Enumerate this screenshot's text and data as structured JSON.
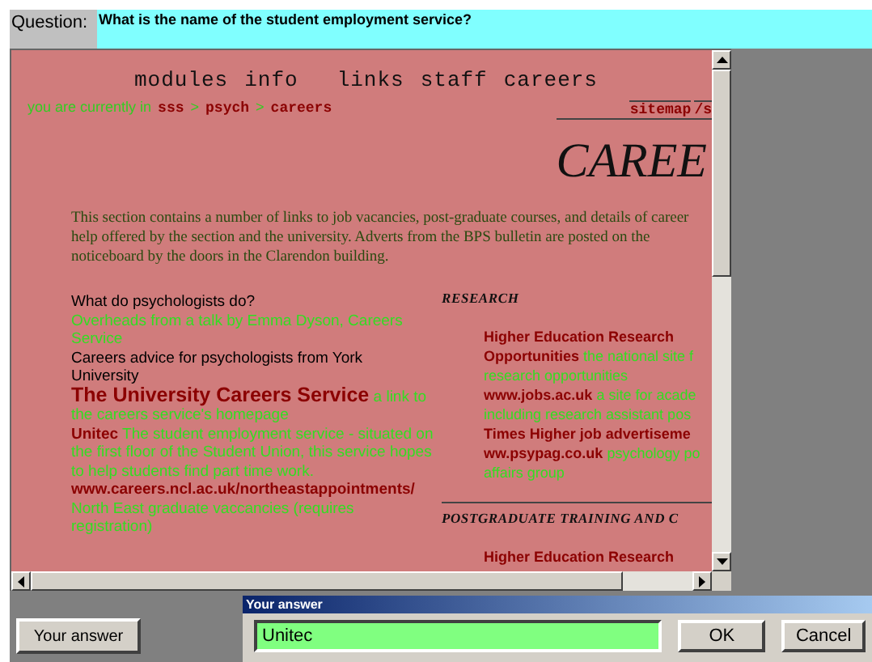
{
  "question": {
    "label": "Question:",
    "text": "What is the name of the student employment service?"
  },
  "page": {
    "nav": [
      "modules",
      "info",
      "links",
      "staff",
      "careers"
    ],
    "breadcrumb": [
      {
        "text": "you are currently in",
        "kind": "plain"
      },
      {
        "text": "sss",
        "kind": "link"
      },
      {
        "text": ">",
        "kind": "plain"
      },
      {
        "text": "psych",
        "kind": "link"
      },
      {
        "text": ">",
        "kind": "plain"
      },
      {
        "text": "careers",
        "kind": "link"
      }
    ],
    "sitemap": [
      "sitemap",
      "/s"
    ],
    "title": "CAREE",
    "intro": [
      "This section contains a number of links to job vacancies, post-graduate courses, and details of career",
      "help offered by the section and the university. Adverts from the BPS bulletin are posted on the",
      "noticeboard by the doors in the Clarendon building."
    ],
    "left_items": [
      [
        {
          "text": "What do psychologists do?",
          "kind": "link"
        }
      ],
      [
        {
          "text": "Overheads from a talk by Emma Dyson, Careers Service",
          "kind": "desc"
        }
      ],
      [
        {
          "text": "Careers advice for psychologists from York University",
          "kind": "link"
        }
      ],
      [
        {
          "text": "The University Careers Service",
          "kind": "biglink"
        },
        {
          "text": "a link to the careers service's homepage",
          "kind": "desc"
        }
      ],
      [
        {
          "text": "Unitec",
          "kind": "link"
        },
        {
          "text": "The student employment service - situated on the first floor of the Student Union, this service hopes to help students find part time work.",
          "kind": "desc"
        }
      ],
      [
        {
          "text": "www.careers.ncl.ac.uk/northeastappointments/",
          "kind": "link"
        },
        {
          "text": "North East graduate vaccancies (requires registration)",
          "kind": "desc"
        }
      ]
    ],
    "research_heading": "RESEARCH",
    "right_lines": [
      [
        {
          "text": "Higher Education Research",
          "kind": "link"
        }
      ],
      [
        {
          "text": "Opportunities",
          "kind": "link"
        },
        {
          "text": "the national site f",
          "kind": "desc"
        }
      ],
      [
        {
          "text": "research opportunities",
          "kind": "desc"
        }
      ],
      [
        {
          "text": "www.jobs.ac.uk",
          "kind": "link"
        },
        {
          "text": "a site for acade",
          "kind": "desc"
        }
      ],
      [
        {
          "text": "including research assistant pos",
          "kind": "desc"
        }
      ],
      [
        {
          "text": "Times Higher job advertiseme",
          "kind": "link"
        }
      ],
      [
        {
          "text": "ww.psypag.co.uk",
          "kind": "link"
        },
        {
          "text": "psychology po",
          "kind": "desc"
        }
      ],
      [
        {
          "text": "affairs group",
          "kind": "desc"
        }
      ]
    ],
    "postgrad_heading": "POSTGRADUATE TRAINING AND C",
    "postgrad_lines": [
      [
        {
          "text": "Higher Education Research",
          "kind": "link"
        }
      ]
    ]
  },
  "answer_button": "Your answer",
  "dialog": {
    "title": "Your answer",
    "value": "Unitec",
    "buttons": [
      "OK",
      "Cancel"
    ]
  }
}
